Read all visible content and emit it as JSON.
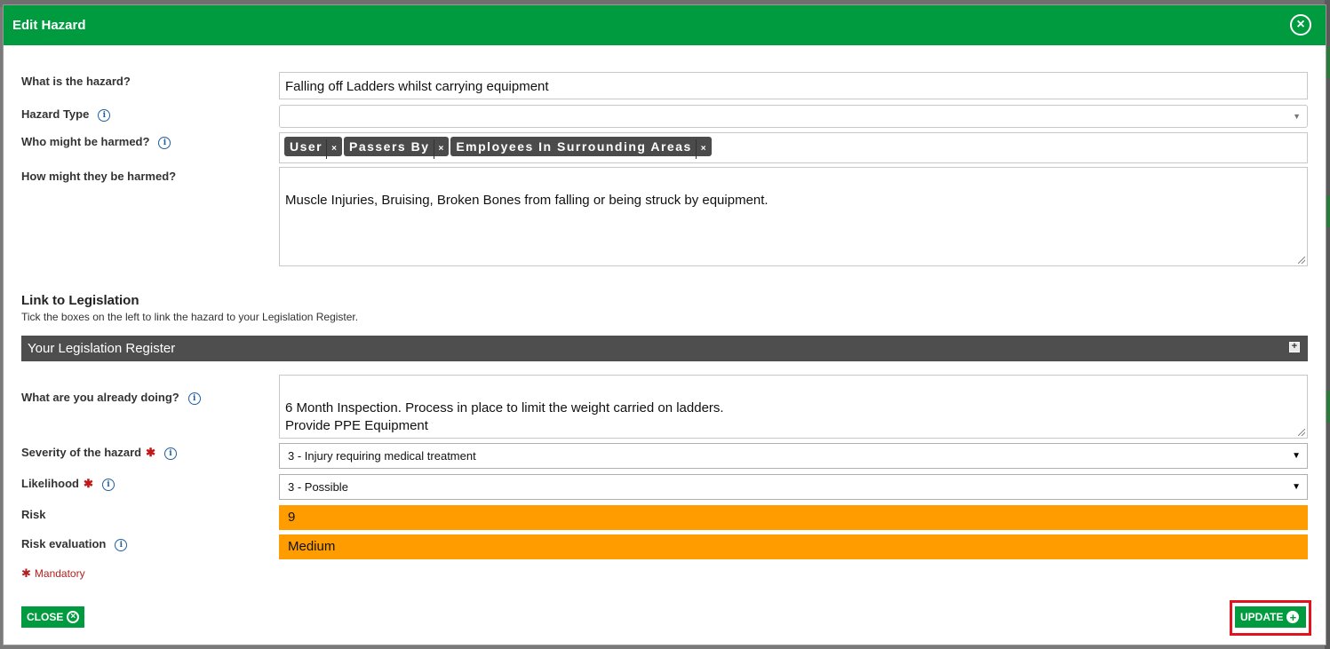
{
  "dialog": {
    "title": "Edit Hazard"
  },
  "form": {
    "hazard": {
      "label": "What is the hazard?",
      "value": "Falling off Ladders whilst carrying equipment"
    },
    "hazard_type": {
      "label": "Hazard Type",
      "value": ""
    },
    "who_harmed": {
      "label": "Who might be harmed?",
      "tags": [
        "User",
        "Passers By",
        "Employees In Surrounding Areas"
      ]
    },
    "how_harmed": {
      "label": "How might they be harmed?",
      "value": "Muscle Injuries, Bruising, Broken Bones from falling or being struck by equipment."
    },
    "legislation": {
      "heading": "Link to Legislation",
      "subtitle": "Tick the boxes on the left to link the hazard to your Legislation Register.",
      "register_title": "Your Legislation Register"
    },
    "already_doing": {
      "label": "What are you already doing?",
      "value": "6 Month Inspection. Process in place to limit the weight carried on ladders.\nProvide PPE Equipment"
    },
    "severity": {
      "label": "Severity of the hazard",
      "value": "3 - Injury requiring medical treatment"
    },
    "likelihood": {
      "label": "Likelihood",
      "value": "3 - Possible"
    },
    "risk": {
      "label": "Risk",
      "value": "9"
    },
    "risk_evaluation": {
      "label": "Risk evaluation",
      "value": "Medium"
    },
    "mandatory_note": "Mandatory"
  },
  "buttons": {
    "close": "CLOSE",
    "update": "UPDATE"
  },
  "colors": {
    "header": "#009b3f",
    "risk": "#ff9c00",
    "highlight": "#e0141e"
  }
}
